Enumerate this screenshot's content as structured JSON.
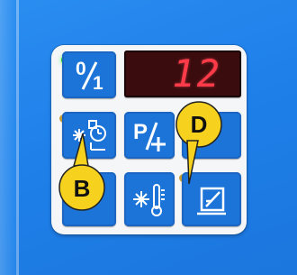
{
  "display": {
    "value": "12",
    "ghost": "88"
  },
  "keys": [
    {
      "name": "power-key",
      "label": "0/1",
      "icon": "power-toggle-icon"
    },
    {
      "name": "mode-key",
      "label": "P/+",
      "icon": "program-plus-icon"
    },
    {
      "name": "defrost-timer-key",
      "icon": "defrost-timer-icon"
    },
    {
      "name": "temperature-key",
      "icon": "snowflake-thermometer-icon"
    },
    {
      "name": "manual-defrost-key",
      "icon": "manual-defrost-icon"
    }
  ],
  "callouts": [
    {
      "label": "B",
      "target": "defrost-timer-key"
    },
    {
      "label": "D",
      "target": "manual-defrost-key"
    }
  ],
  "colors": {
    "background": "#1f80ea",
    "key": "#1d74d8",
    "led_green": "#25d02a",
    "led_amber": "#c9a035",
    "callout": "#f6d21e",
    "display_text": "#ff3b4a"
  }
}
